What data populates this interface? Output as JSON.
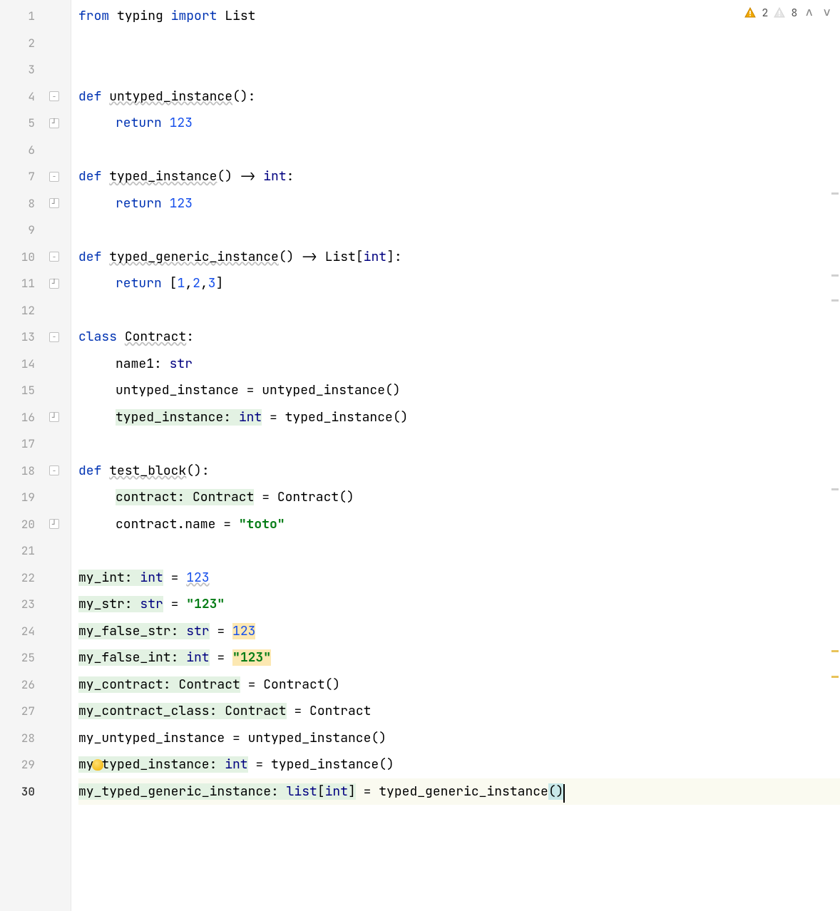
{
  "inspections": {
    "warnings_strong": 2,
    "warnings_weak": 8
  },
  "lines": [
    {
      "n": 1,
      "fold": null
    },
    {
      "n": 2,
      "fold": null
    },
    {
      "n": 3,
      "fold": null
    },
    {
      "n": 4,
      "fold": "open"
    },
    {
      "n": 5,
      "fold": "close"
    },
    {
      "n": 6,
      "fold": null
    },
    {
      "n": 7,
      "fold": "open"
    },
    {
      "n": 8,
      "fold": "close"
    },
    {
      "n": 9,
      "fold": null
    },
    {
      "n": 10,
      "fold": "open"
    },
    {
      "n": 11,
      "fold": "close"
    },
    {
      "n": 12,
      "fold": null
    },
    {
      "n": 13,
      "fold": "open"
    },
    {
      "n": 14,
      "fold": null
    },
    {
      "n": 15,
      "fold": null
    },
    {
      "n": 16,
      "fold": "close"
    },
    {
      "n": 17,
      "fold": null
    },
    {
      "n": 18,
      "fold": "open"
    },
    {
      "n": 19,
      "fold": null
    },
    {
      "n": 20,
      "fold": "close"
    },
    {
      "n": 21,
      "fold": null
    },
    {
      "n": 22,
      "fold": null
    },
    {
      "n": 23,
      "fold": null
    },
    {
      "n": 24,
      "fold": null
    },
    {
      "n": 25,
      "fold": null
    },
    {
      "n": 26,
      "fold": null
    },
    {
      "n": 27,
      "fold": null
    },
    {
      "n": 28,
      "fold": null
    },
    {
      "n": 29,
      "fold": null
    },
    {
      "n": 30,
      "fold": null
    }
  ],
  "code": {
    "l1": {
      "from": "from",
      "mod": "typing",
      "import": "import",
      "name": "List"
    },
    "l4": {
      "def": "def",
      "name": "untyped_instance",
      "sig": "():"
    },
    "l5": {
      "ret": "return",
      "val": "123"
    },
    "l7": {
      "def": "def",
      "name": "typed_instance",
      "arrow": "() -> ",
      "type": "int",
      "end": ":"
    },
    "l8": {
      "ret": "return",
      "val": "123"
    },
    "l10": {
      "def": "def",
      "name": "typed_generic_instance",
      "arrow": "() -> ",
      "type1": "List",
      "b1": "[",
      "type2": "int",
      "b2": "]",
      "end": ":"
    },
    "l11": {
      "ret": "return",
      "b1": "[",
      "v1": "1",
      "v2": "2",
      "v3": "3",
      "b2": "]"
    },
    "l13": {
      "cls": "class",
      "name": "Contract",
      "end": ":"
    },
    "l14": {
      "name": "name1",
      "colon": ": ",
      "type": "str"
    },
    "l15": {
      "lhs": "untyped_instance",
      "eq": " = ",
      "rhs": "untyped_instance()"
    },
    "l16": {
      "lhs": "typed_instance: ",
      "type": "int",
      "eq": " = ",
      "rhs": "typed_instance()"
    },
    "l18": {
      "def": "def",
      "name": "test_block",
      "sig": "():"
    },
    "l19": {
      "lhs": "contract: Contract",
      "eq": " = ",
      "rhs": "Contract()"
    },
    "l20": {
      "lhs": "contract.name",
      "eq": " = ",
      "val": "\"toto\""
    },
    "l22": {
      "lhs": "my_int: ",
      "type": "int",
      "eq": " = ",
      "val": "123"
    },
    "l23": {
      "lhs": "my_str: ",
      "type": "str",
      "eq": " = ",
      "val": "\"123\""
    },
    "l24": {
      "lhs": "my_false_str: ",
      "type": "str",
      "eq": " = ",
      "val": "123"
    },
    "l25": {
      "lhs": "my_false_int: ",
      "type": "int",
      "eq": " = ",
      "val": "\"123\""
    },
    "l26": {
      "lhs": "my_contract: Contract",
      "eq": " = ",
      "rhs": "Contract()"
    },
    "l27": {
      "lhs": "my_contract_class: Contract",
      "eq": " = ",
      "rhs": "Contract"
    },
    "l28": {
      "lhs": "my_untyped_instance",
      "eq": " = ",
      "rhs": "untyped_instance()"
    },
    "l29": {
      "lhs": "my_typed_instance: ",
      "type": "int",
      "eq": " = ",
      "rhs": "typed_instance()"
    },
    "l30": {
      "lhs": "my_typed_generic_instance: ",
      "type": "list",
      "b1": "[",
      "type2": "int",
      "b2": "]",
      "eq": " = ",
      "rhs": "typed_generic_instance",
      "p1": "(",
      "p2": ")"
    }
  },
  "markers": [
    {
      "line": 7,
      "kind": "weak"
    },
    {
      "line": 10,
      "kind": "weak"
    },
    {
      "line": 11,
      "kind": "weak"
    },
    {
      "line": 18,
      "kind": "weak"
    },
    {
      "line": 24,
      "kind": "warn"
    },
    {
      "line": 25,
      "kind": "warn"
    }
  ]
}
